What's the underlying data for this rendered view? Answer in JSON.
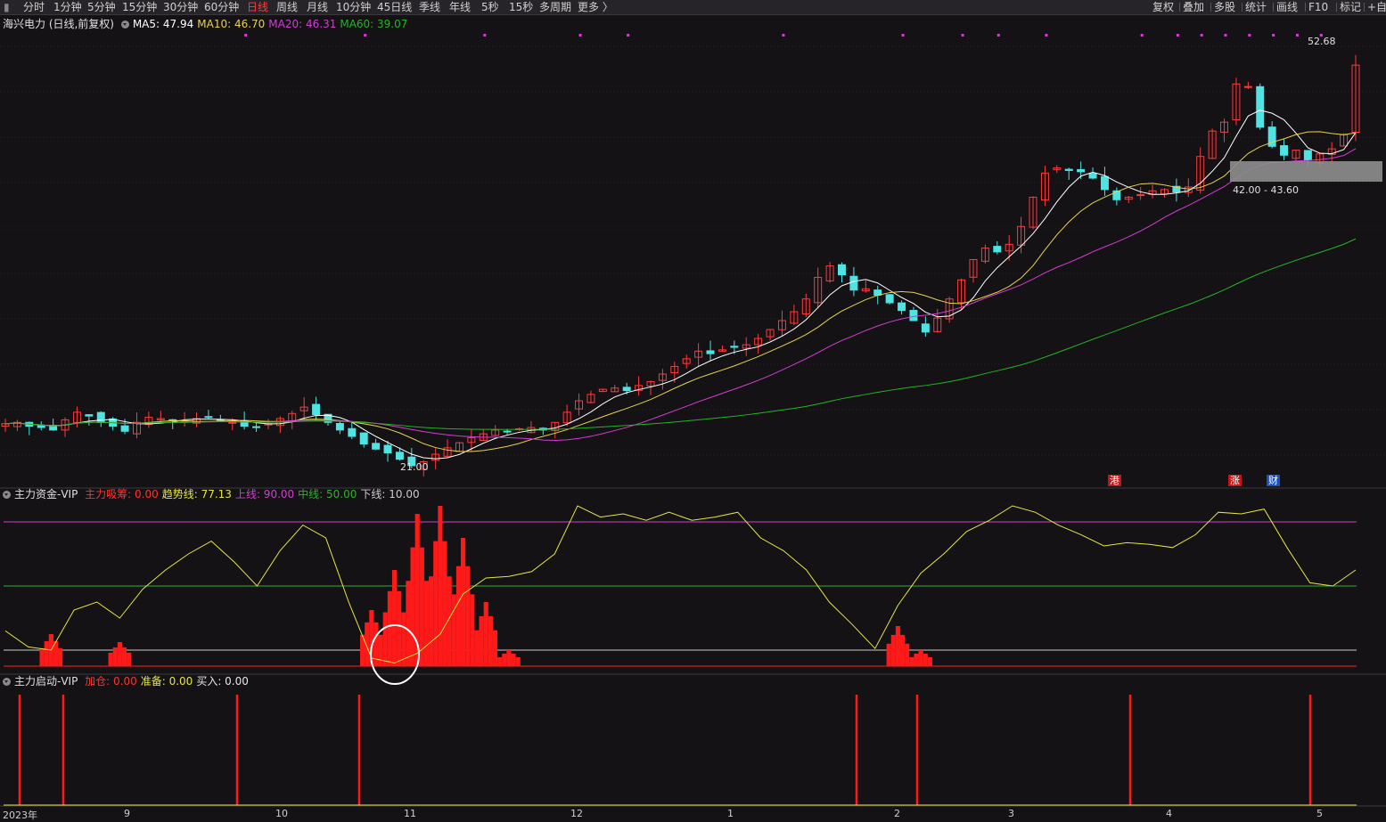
{
  "toolbar": {
    "left": [
      "分时",
      "1分钟",
      "5分钟",
      "15分钟",
      "30分钟",
      "60分钟",
      "日线",
      "周线",
      "月线",
      "10分钟",
      "45日线",
      "季线",
      "年线",
      "5秒",
      "15秒",
      "多周期",
      "更多 〉"
    ],
    "active": "日线",
    "right": [
      "复权",
      "叠加",
      "多股",
      "统计",
      "画线",
      "F10",
      "标记",
      "+自"
    ]
  },
  "main_panel": {
    "title": "海兴电力 (日线,前复权)",
    "ma": [
      {
        "label": "MA5: 47.94",
        "color": "#ffffff"
      },
      {
        "label": "MA10: 46.70",
        "color": "#e6d34a"
      },
      {
        "label": "MA20: 46.31",
        "color": "#d43cd4"
      },
      {
        "label": "MA60: 39.07",
        "color": "#22b522"
      }
    ],
    "high_label": "52.68",
    "low_label": "21.00",
    "range_box_label": "42.00 - 43.60",
    "event_badges": [
      {
        "text": "港",
        "color": "#e02020"
      },
      {
        "text": "涨",
        "color": "#e02020"
      },
      {
        "text": "财",
        "color": "#2060e0"
      }
    ]
  },
  "panel1": {
    "title": "主力资金-VIP",
    "items": [
      {
        "label": "主力吸筹: 0.00",
        "color": "#ff3030"
      },
      {
        "label": "趋势线: 77.13",
        "color": "#e6e640"
      },
      {
        "label": "上线: 90.00",
        "color": "#d040d0"
      },
      {
        "label": "中线: 50.00",
        "color": "#30b030"
      },
      {
        "label": "下线: 10.00",
        "color": "#cccccc"
      }
    ]
  },
  "panel2": {
    "title": "主力启动-VIP",
    "items": [
      {
        "label": "加仓: 0.00",
        "color": "#ff3030"
      },
      {
        "label": "准备: 0.00",
        "color": "#e6e640"
      },
      {
        "label": "买入: 0.00",
        "color": "#e6e6e6"
      }
    ]
  },
  "x_axis": [
    "2023年",
    "9",
    "10",
    "11",
    "12",
    "1",
    "2",
    "3",
    "4",
    "5"
  ],
  "colors": {
    "up": "#ff3b3b",
    "down": "#4fe3e3",
    "bg": "#141215"
  },
  "chart_data": [
    {
      "type": "candlestick",
      "title": "海兴电力 (日线,前复权)",
      "y_range": [
        20,
        55
      ],
      "x_months": [
        "2023-08",
        "2023-09",
        "2023-10",
        "2023-11",
        "2023-12",
        "2024-01",
        "2024-02",
        "2024-03",
        "2024-04",
        "2024-05"
      ],
      "close_trend": [
        24.5,
        24.6,
        24.3,
        24.2,
        24.0,
        24.8,
        25.4,
        25.1,
        24.6,
        24.3,
        23.9,
        24.6,
        25.0,
        24.9,
        24.8,
        24.7,
        24.9,
        25.0,
        24.8,
        24.6,
        24.3,
        24.2,
        24.5,
        24.9,
        25.3,
        25.8,
        25.2,
        24.6,
        24.0,
        23.5,
        22.9,
        22.5,
        22.2,
        21.7,
        21.2,
        21.5,
        22.1,
        22.6,
        23.0,
        23.4,
        23.7,
        24.0,
        23.9,
        24.1,
        24.2,
        24.0,
        24.6,
        25.4,
        26.3,
        26.8,
        27.2,
        27.3,
        27.1,
        27.5,
        27.8,
        28.4,
        29.0,
        29.6,
        30.2,
        30.0,
        30.3,
        30.5,
        30.7,
        31.2,
        31.9,
        32.6,
        33.3,
        34.3,
        36.0,
        36.9,
        36.2,
        35.0,
        35.1,
        34.6,
        34.0,
        33.4,
        32.6,
        31.7,
        32.8,
        34.3,
        35.8,
        37.4,
        38.3,
        38.0,
        38.6,
        40.0,
        42.3,
        44.2,
        44.6,
        44.4,
        44.3,
        43.8,
        42.9,
        42.1,
        42.3,
        42.5,
        42.8,
        42.9,
        42.7,
        43.1,
        45.5,
        47.5,
        48.2,
        51.2,
        51.0,
        47.8,
        46.3,
        45.6,
        46.0,
        45.2,
        45.7,
        46.1,
        47.2,
        52.68
      ],
      "ma_lines": [
        "MA5",
        "MA10",
        "MA20",
        "MA60"
      ],
      "annotations": [
        "52.68",
        "21.00",
        "42.00 - 43.60"
      ]
    },
    {
      "type": "line",
      "title": "主力资金-VIP",
      "y_range": [
        0,
        100
      ],
      "series": [
        {
          "name": "趋势线",
          "values": [
            22,
            12,
            10,
            35,
            40,
            30,
            48,
            60,
            70,
            78,
            65,
            50,
            72,
            88,
            80,
            40,
            5,
            2,
            8,
            20,
            45,
            55,
            56,
            59,
            70,
            100,
            93,
            95,
            91,
            96,
            91,
            93,
            96,
            80,
            72,
            60,
            40,
            26,
            11,
            38,
            58,
            70,
            84,
            91,
            100,
            96,
            88,
            82,
            75,
            77,
            76,
            74,
            82,
            96,
            95,
            98,
            74,
            52,
            50,
            60
          ]
        },
        {
          "name": "主力吸筹",
          "values": [
            0,
            0,
            20,
            0,
            0,
            15,
            0,
            0,
            0,
            0,
            0,
            0,
            0,
            0,
            0,
            0,
            35,
            60,
            95,
            100,
            80,
            40,
            10,
            0,
            0,
            0,
            0,
            0,
            0,
            0,
            0,
            0,
            0,
            0,
            0,
            0,
            0,
            0,
            0,
            25,
            10,
            0,
            0,
            0,
            0,
            0,
            0,
            0,
            0,
            0,
            0,
            0,
            0,
            0,
            0,
            0,
            0,
            0,
            0,
            0
          ]
        },
        {
          "name": "上线",
          "values": [
            90
          ]
        },
        {
          "name": "中线",
          "values": [
            50
          ]
        },
        {
          "name": "下线",
          "values": [
            10
          ]
        }
      ]
    },
    {
      "type": "bar",
      "title": "主力启动-VIP",
      "series": [
        {
          "name": "加仓",
          "values": [
            1,
            1,
            1,
            1,
            1,
            1,
            1,
            1,
            1
          ]
        }
      ],
      "x_months_of_signals": [
        "2023-08",
        "2023-08",
        "2023-10",
        "2023-10",
        "2024-02",
        "2024-02",
        "2024-04",
        "2024-05"
      ]
    }
  ]
}
